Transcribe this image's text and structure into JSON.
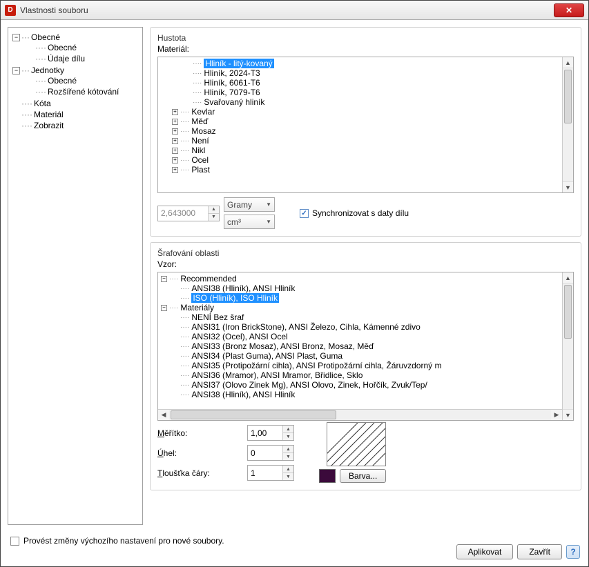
{
  "window": {
    "title": "Vlastnosti souboru",
    "app_icon": "D"
  },
  "nav": {
    "items": [
      {
        "label": "Obecné",
        "children": [
          {
            "label": "Obecné"
          },
          {
            "label": "Údaje dílu"
          }
        ]
      },
      {
        "label": "Jednotky",
        "children": [
          {
            "label": "Obecné"
          },
          {
            "label": "Rozšířené kótování"
          }
        ]
      },
      {
        "label": "Kóta"
      },
      {
        "label": "Materiál"
      },
      {
        "label": "Zobrazit"
      }
    ]
  },
  "density": {
    "group": "Hustota",
    "label": "Materiál:",
    "tree": [
      {
        "label": "Hliník - litý-kovaný",
        "level": 2,
        "selected": true
      },
      {
        "label": "Hliník, 2024-T3",
        "level": 2
      },
      {
        "label": "Hliník, 6061-T6",
        "level": 2
      },
      {
        "label": "Hliník, 7079-T6",
        "level": 2
      },
      {
        "label": "Svařovaný hliník",
        "level": 2
      },
      {
        "label": "Kevlar",
        "level": 1,
        "expand": "+"
      },
      {
        "label": "Měď",
        "level": 1,
        "expand": "+"
      },
      {
        "label": "Mosaz",
        "level": 1,
        "expand": "+"
      },
      {
        "label": "Není",
        "level": 1,
        "expand": "+"
      },
      {
        "label": "Nikl",
        "level": 1,
        "expand": "+"
      },
      {
        "label": "Ocel",
        "level": 1,
        "expand": "+"
      },
      {
        "label": "Plast",
        "level": 1,
        "expand": "+"
      }
    ],
    "value": "2,643000",
    "unit_mass": "Gramy",
    "unit_vol": "cm³",
    "sync_label": "Synchronizovat s daty dílu",
    "sync_checked": true
  },
  "hatch": {
    "group": "Šrafování oblasti",
    "label": "Vzor:",
    "tree": [
      {
        "label": "Recommended",
        "level": 0,
        "expand": "−"
      },
      {
        "label": "ANSI38 (Hliník), ANSI Hliník",
        "level": 1
      },
      {
        "label": "ISO (Hliník), ISO Hliník",
        "level": 1,
        "selected": true
      },
      {
        "label": "Materiály",
        "level": 0,
        "expand": "−"
      },
      {
        "label": "NENÍ Bez šraf",
        "level": 1
      },
      {
        "label": "ANSI31 (Iron BrickStone), ANSI Železo, Cihla, Kámenné zdivo",
        "level": 1
      },
      {
        "label": "ANSI32 (Ocel), ANSI Ocel",
        "level": 1
      },
      {
        "label": "ANSI33 (Bronz Mosaz), ANSI Bronz, Mosaz, Měď",
        "level": 1
      },
      {
        "label": "ANSI34 (Plast Guma), ANSI Plast, Guma",
        "level": 1
      },
      {
        "label": "ANSI35 (Protipožární cihla), ANSI Protipožární cihla, Žáruvzdorný m",
        "level": 1
      },
      {
        "label": "ANSI36 (Mramor), ANSI Mramor, Břidlice, Sklo",
        "level": 1
      },
      {
        "label": "ANSI37 (Olovo Zinek Mg), ANSI Olovo, Zinek, Hořčík, Zvuk/Tep/",
        "level": 1
      },
      {
        "label": "ANSI38 (Hliník), ANSI Hliník",
        "level": 1
      }
    ],
    "scale_label": "Měřítko:",
    "scale_accel": "M",
    "scale_value": "1,00",
    "angle_label": "Úhel:",
    "angle_accel": "Ú",
    "angle_value": "0",
    "thickness_label": "Tloušťka čáry:",
    "thickness_accel": "T",
    "thickness_value": "1",
    "color_button": "Barva..."
  },
  "footer": {
    "default_check": "Provést změny výchozího nastavení pro nové soubory.",
    "apply": "Aplikovat",
    "close": "Zavřít"
  }
}
